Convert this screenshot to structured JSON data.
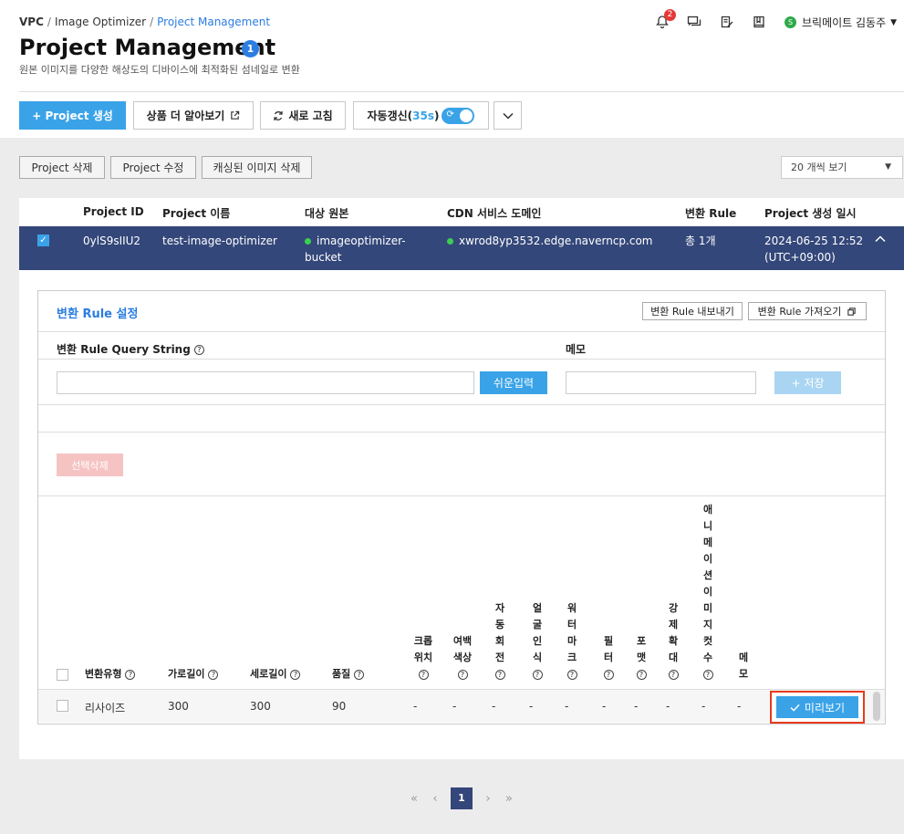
{
  "breadcrumb": {
    "items": [
      "VPC",
      "Image Optimizer",
      "Project Management"
    ]
  },
  "page": {
    "title": "Project Management",
    "badge": "1",
    "subtitle": "원본 이미지를 다양한 해상도의 디바이스에 최적화된 섬네일로 변환"
  },
  "header": {
    "notification_count": "2",
    "user_initial": "S",
    "user_name": "브릭메이트 김동주",
    "icons": [
      "bell-icon",
      "chat-icon",
      "edit-note-icon",
      "book-icon"
    ]
  },
  "toolbar": {
    "create": "+ Project 생성",
    "learn_more": "상품 더 알아보기",
    "refresh": "새로 고침",
    "auto_refresh": "자동갱신(",
    "auto_refresh_time": "35s",
    "auto_refresh_close": ")",
    "auto_refresh_on": true
  },
  "actions": {
    "delete": "Project 삭제",
    "edit": "Project 수정",
    "purge_cache": "캐싱된 이미지 삭제",
    "page_size": "20 개씩 보기"
  },
  "table": {
    "headers": [
      "Project ID",
      "Project 이름",
      "대상 원본",
      "CDN 서비스 도메인",
      "변환 Rule",
      "Project 생성 일시"
    ],
    "row": {
      "selected": true,
      "id": "0ylS9sIIU2",
      "name": "test-image-optimizer",
      "origin_line1": "imageoptimizer-",
      "origin_line2": "bucket",
      "cdn": "xwrod8yp3532.edge.naverncp.com",
      "rules": "총 1개",
      "created_line1": "2024-06-25 12:52",
      "created_line2": "(UTC+09:00)"
    }
  },
  "rule_panel": {
    "title": "변환 Rule 설정",
    "export": "변환 Rule 내보내기",
    "import": "변환 Rule 가져오기",
    "query_label": "변환 Rule Query String",
    "query_value": "",
    "easy_input": "쉬운입력",
    "memo_label": "메모",
    "memo_value": "",
    "save": "+ 저장",
    "delete_selected": "선택삭제"
  },
  "rule_grid": {
    "headers": [
      {
        "label": "변환유형"
      },
      {
        "label": "가로길이"
      },
      {
        "label": "세로길이"
      },
      {
        "label": "품질"
      },
      {
        "label": "크롭\n위치"
      },
      {
        "label": "여백\n색상"
      },
      {
        "label": "자\n동\n회\n전"
      },
      {
        "label": "얼\n굴\n인\n식"
      },
      {
        "label": "워\n터\n마\n크"
      },
      {
        "label": "필\n터"
      },
      {
        "label": "포\n맷"
      },
      {
        "label": "강\n제\n확\n대"
      },
      {
        "label": "애\n니\n메\n이\n션\n이\n미\n지\n컷\n수"
      },
      {
        "label": "메\n모"
      }
    ],
    "row": {
      "type": "리사이즈",
      "width": "300",
      "height": "300",
      "quality": "90",
      "crop": "-",
      "margin": "-",
      "rotate": "-",
      "face": "-",
      "watermark": "-",
      "filter": "-",
      "format": "-",
      "upscale": "-",
      "anim": "-",
      "memo": "-",
      "preview": "미리보기"
    }
  },
  "pagination": {
    "current": "1"
  },
  "colors": {
    "accent": "#3aa3e8",
    "selected_row": "#34477a",
    "highlight": "#e63a1e"
  }
}
